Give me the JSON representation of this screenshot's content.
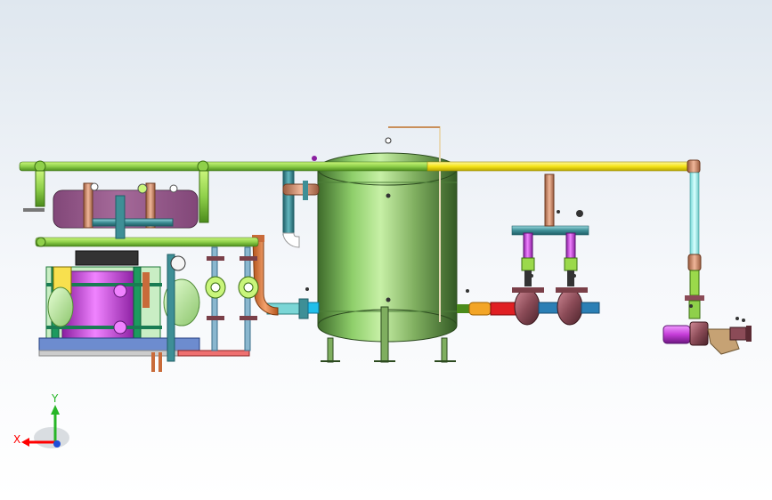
{
  "viewport": {
    "background_top": "#dfe7ef",
    "background_bottom": "#ffffff"
  },
  "triad": {
    "x_label": "X",
    "y_label": "Y",
    "x_color": "#ff0000",
    "y_color": "#27b627",
    "z_color": "#1f4fd8"
  },
  "colors": {
    "tank": "#7fae5f",
    "tank_dark": "#4c7d38",
    "green_pipe": "#9bd94b",
    "yellow_pipe": "#f6e418",
    "magenta": "#d54be2",
    "teal_pipe": "#3e8f96",
    "orange_pipe": "#e2894f",
    "pump_body": "#8b4b57",
    "blue_pipe": "#2b7fb5",
    "red_pipe": "#e01f23"
  }
}
